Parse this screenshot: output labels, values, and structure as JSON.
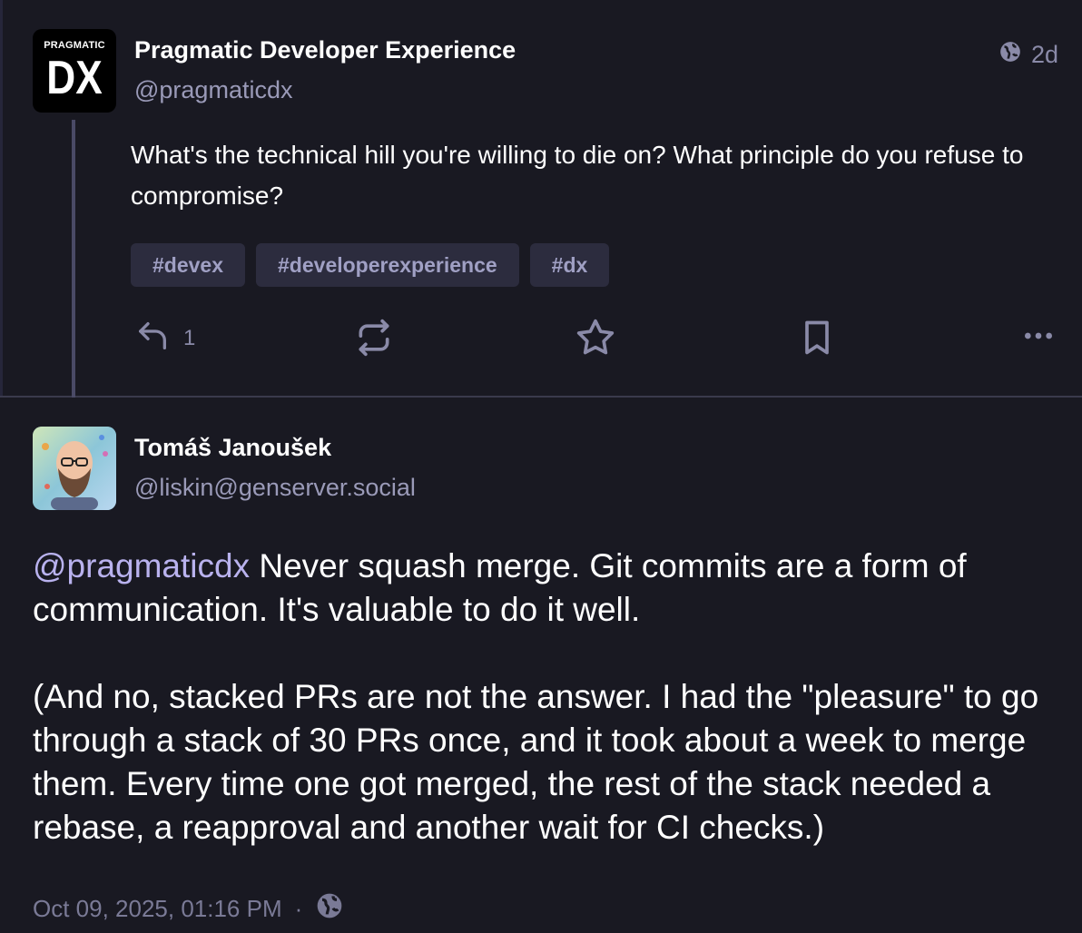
{
  "post": {
    "author_name": "Pragmatic Developer Experience",
    "author_handle": "@pragmaticdx",
    "avatar_text_small": "PRAGMATIC",
    "avatar_text_big": "DX",
    "visibility_icon": "globe-icon",
    "relative_time": "2d",
    "content": "What's the technical hill you're willing to die on? What principle do you refuse to compromise?",
    "hashtags": [
      "#devex",
      "#developerexperience",
      "#dx"
    ],
    "actions": {
      "reply_icon": "reply-icon",
      "reply_count": "1",
      "boost_icon": "boost-icon",
      "favourite_icon": "star-icon",
      "bookmark_icon": "bookmark-icon",
      "more_icon": "more-icon"
    }
  },
  "reply": {
    "author_name": "Tomáš Janoušek",
    "author_handle": "@liskin@genserver.social",
    "mention": "@pragmaticdx",
    "paragraph1_rest": " Never squash merge. Git commits are a form of communication. It's valuable to do it well.",
    "paragraph2": "(And no, stacked PRs are not the answer. I had the \"pleasure\" to go through a stack of 30 PRs once, and it took about a week to merge them. Every time one got merged, the rest of the stack needed a rebase, a reapproval and another wait for CI checks.)",
    "timestamp": "Oct 09, 2025, 01:16 PM",
    "separator": "·",
    "visibility_icon": "globe-icon"
  },
  "colors": {
    "background": "#191922",
    "text": "#ffffff",
    "muted": "#8a8aa8",
    "mention": "#b9b2ee",
    "tag_bg": "#2c2c3e",
    "thread_line": "#4a4a66"
  }
}
